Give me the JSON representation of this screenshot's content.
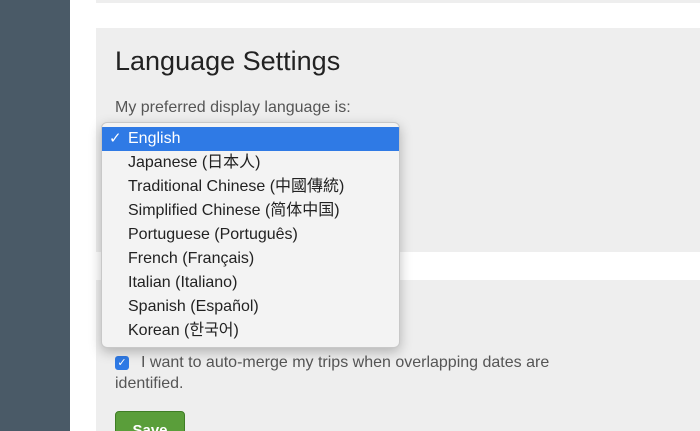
{
  "language_settings": {
    "title": "Language Settings",
    "label": "My preferred display language is:",
    "selected": "English",
    "options": [
      {
        "label": "English",
        "selected": true
      },
      {
        "label": "Japanese (日本人)",
        "selected": false
      },
      {
        "label": "Traditional Chinese (中國傳統)",
        "selected": false
      },
      {
        "label": "Simplified Chinese (简体中国)",
        "selected": false
      },
      {
        "label": "Portuguese (Português)",
        "selected": false
      },
      {
        "label": "French (Français)",
        "selected": false
      },
      {
        "label": "Italian (Italiano)",
        "selected": false
      },
      {
        "label": "Spanish (Español)",
        "selected": false
      },
      {
        "label": "Korean (한국어)",
        "selected": false
      }
    ],
    "check_glyph": "✓"
  },
  "trips": {
    "auto_merge_label": "I want to auto-merge my trips when overlapping dates are identified.",
    "auto_merge_checked": true,
    "checkbox_glyph": "✓"
  },
  "actions": {
    "save_label": "Save"
  },
  "colors": {
    "sidebar": "#4a5a67",
    "panel": "#eeeeee",
    "accent": "#2f7ae5",
    "save_button": "#5a9e3a"
  }
}
